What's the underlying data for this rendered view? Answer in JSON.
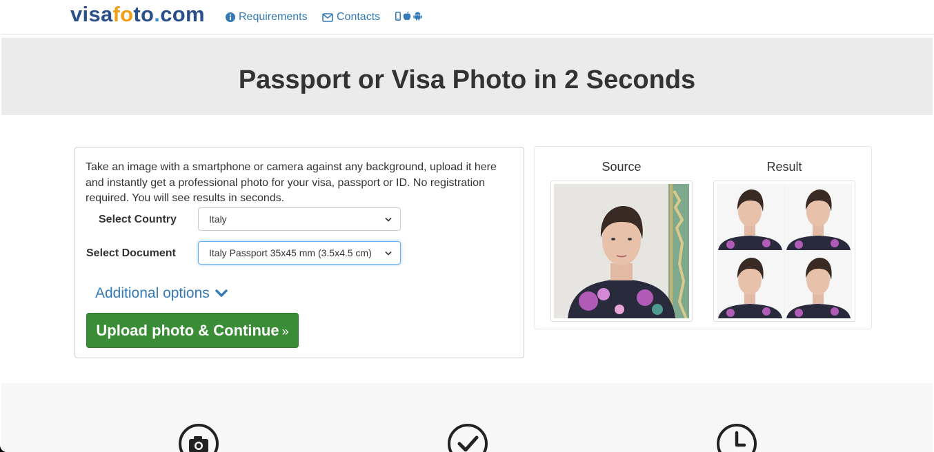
{
  "nav": {
    "logo_parts": [
      "visa",
      "f",
      "o",
      "to",
      ".",
      "com"
    ],
    "requirements_label": "Requirements",
    "contacts_label": "Contacts"
  },
  "hero": {
    "title": "Passport or Visa Photo in 2 Seconds"
  },
  "form": {
    "intro_text": "Take an image with a smartphone or camera against any background, upload it here and instantly get a professional photo for your visa, passport or ID. No registration required. You will see results in seconds.",
    "country_label": "Select Country",
    "country_value": "Italy",
    "document_label": "Select Document",
    "document_value": "Italy Passport 35x45 mm (3.5x4.5 cm)",
    "additional_options_label": "Additional options",
    "upload_button_label": "Upload photo & Continue",
    "upload_button_suffix": "»"
  },
  "preview": {
    "source_title": "Source",
    "result_title": "Result"
  },
  "colors": {
    "link": "#337ab7",
    "button_green": "#3b8c37",
    "hero_bg": "#ebebeb",
    "logo_blue": "#2a4f8a",
    "logo_orange": "#f0a016"
  },
  "features": {
    "icons": [
      "camera-icon",
      "check-circle-icon",
      "clock-icon"
    ]
  }
}
